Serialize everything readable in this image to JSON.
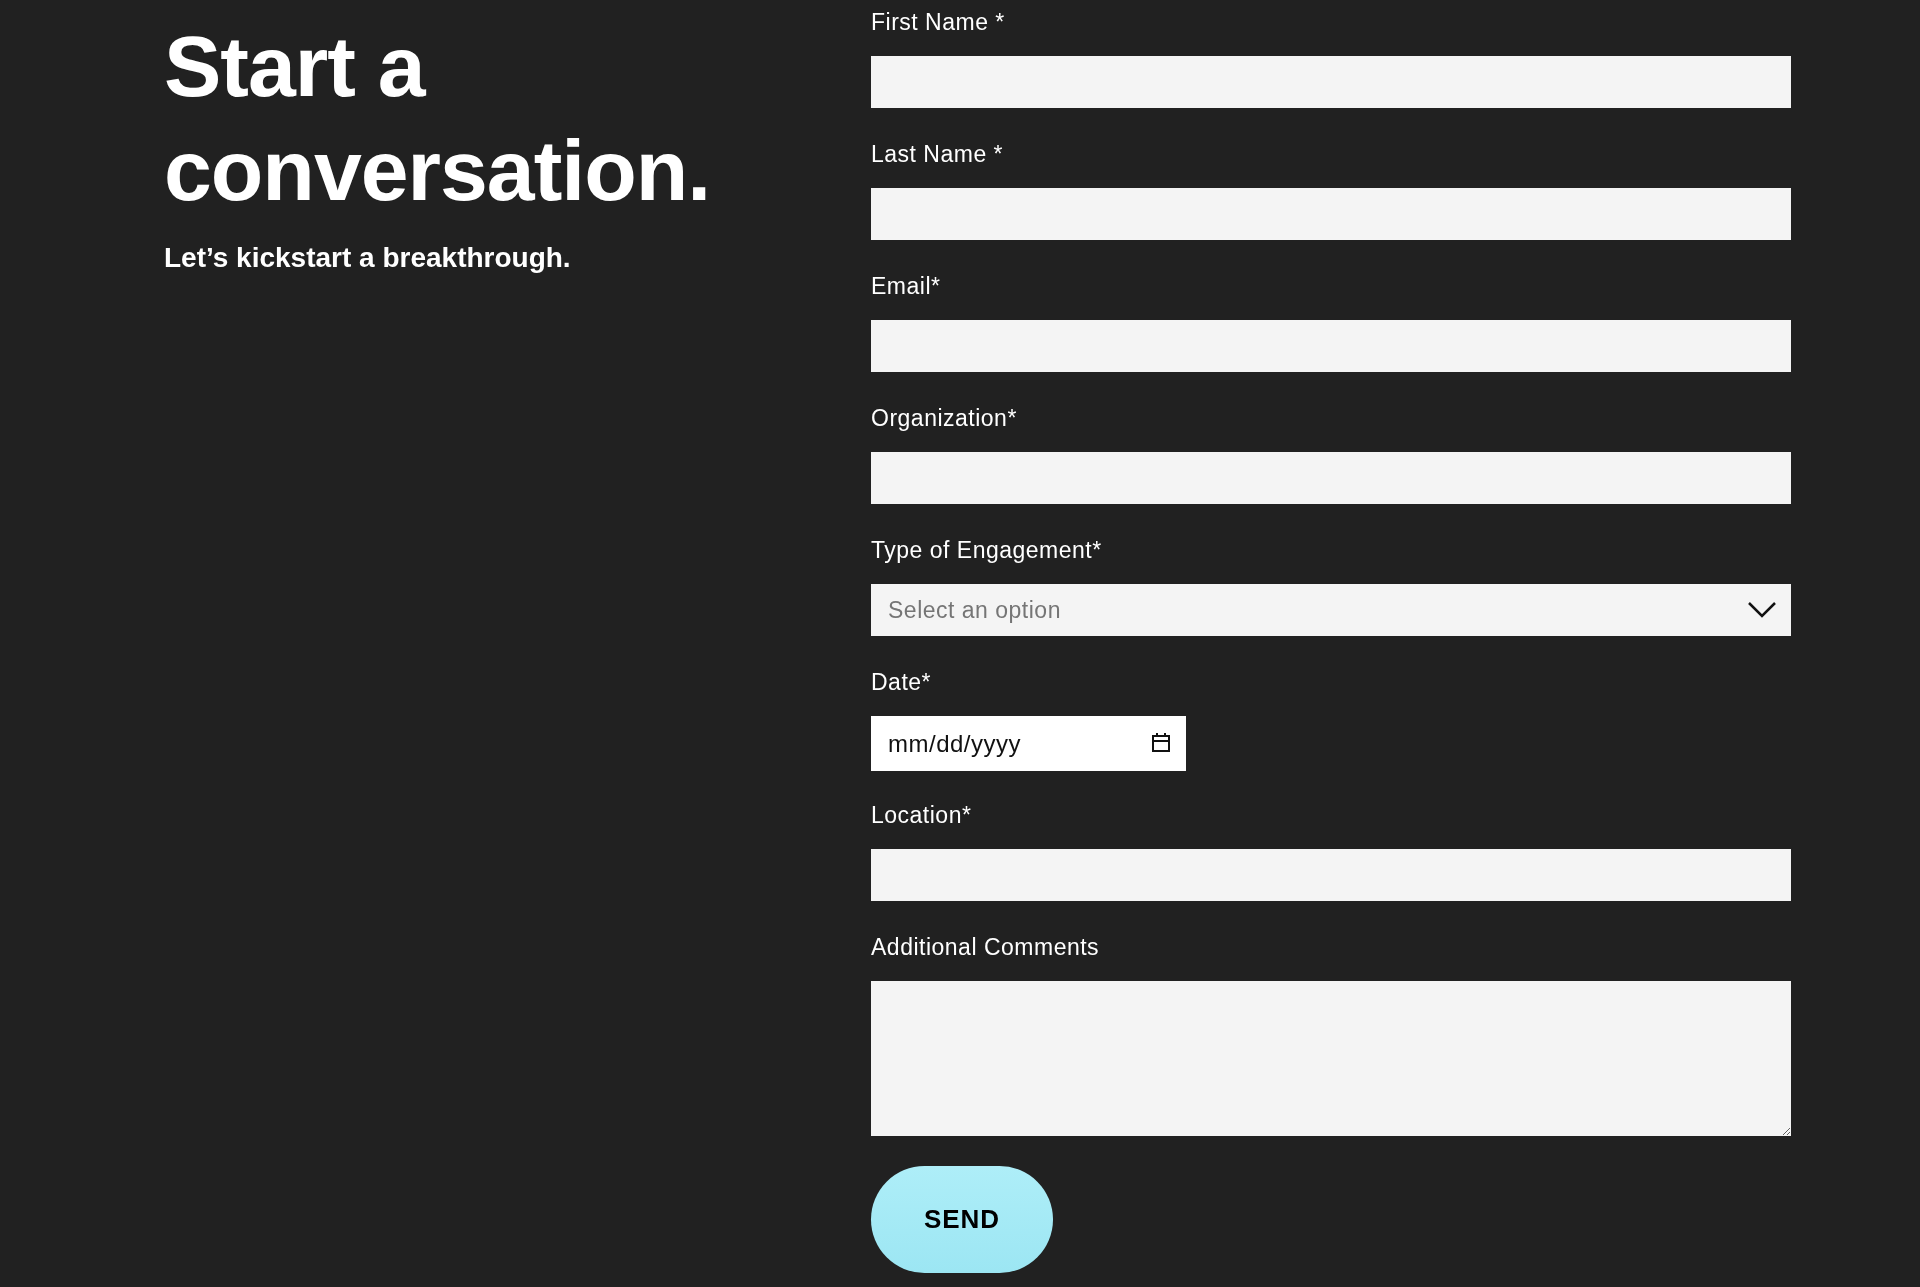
{
  "intro": {
    "heading": "Start a conversation.",
    "subtitle": "Let’s kickstart a breakthrough."
  },
  "form": {
    "fields": [
      {
        "kind": "text",
        "label": "First Name *"
      },
      {
        "kind": "text",
        "label": "Last Name *"
      },
      {
        "kind": "text",
        "label": "Email*"
      },
      {
        "kind": "text",
        "label": "Organization*"
      },
      {
        "kind": "select",
        "label": "Type of Engagement*",
        "placeholder": "Select an option"
      },
      {
        "kind": "date",
        "label": "Date*",
        "placeholder": "mm/dd/yyyy"
      },
      {
        "kind": "text",
        "label": "Location*"
      },
      {
        "kind": "textarea",
        "label": "Additional Comments"
      }
    ],
    "submit": "SEND"
  }
}
